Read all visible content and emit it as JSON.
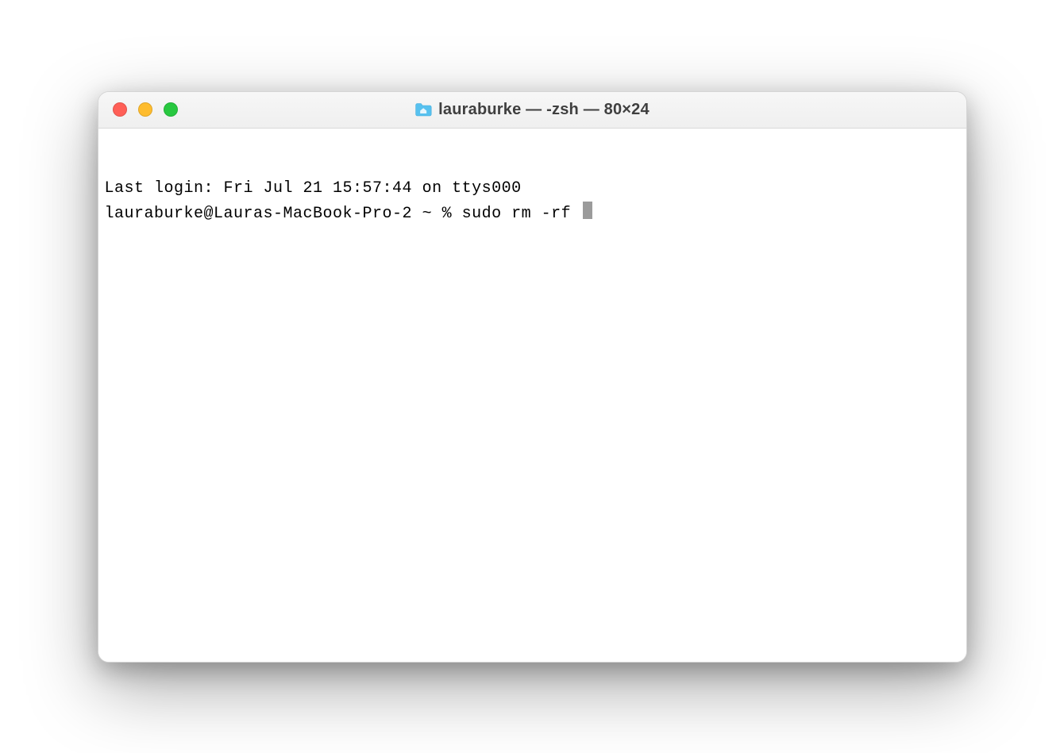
{
  "window": {
    "title": "lauraburke — -zsh — 80×24"
  },
  "terminal": {
    "last_login": "Last login: Fri Jul 21 15:57:44 on ttys000",
    "prompt": "lauraburke@Lauras-MacBook-Pro-2 ~ % ",
    "command": "sudo rm -rf "
  }
}
